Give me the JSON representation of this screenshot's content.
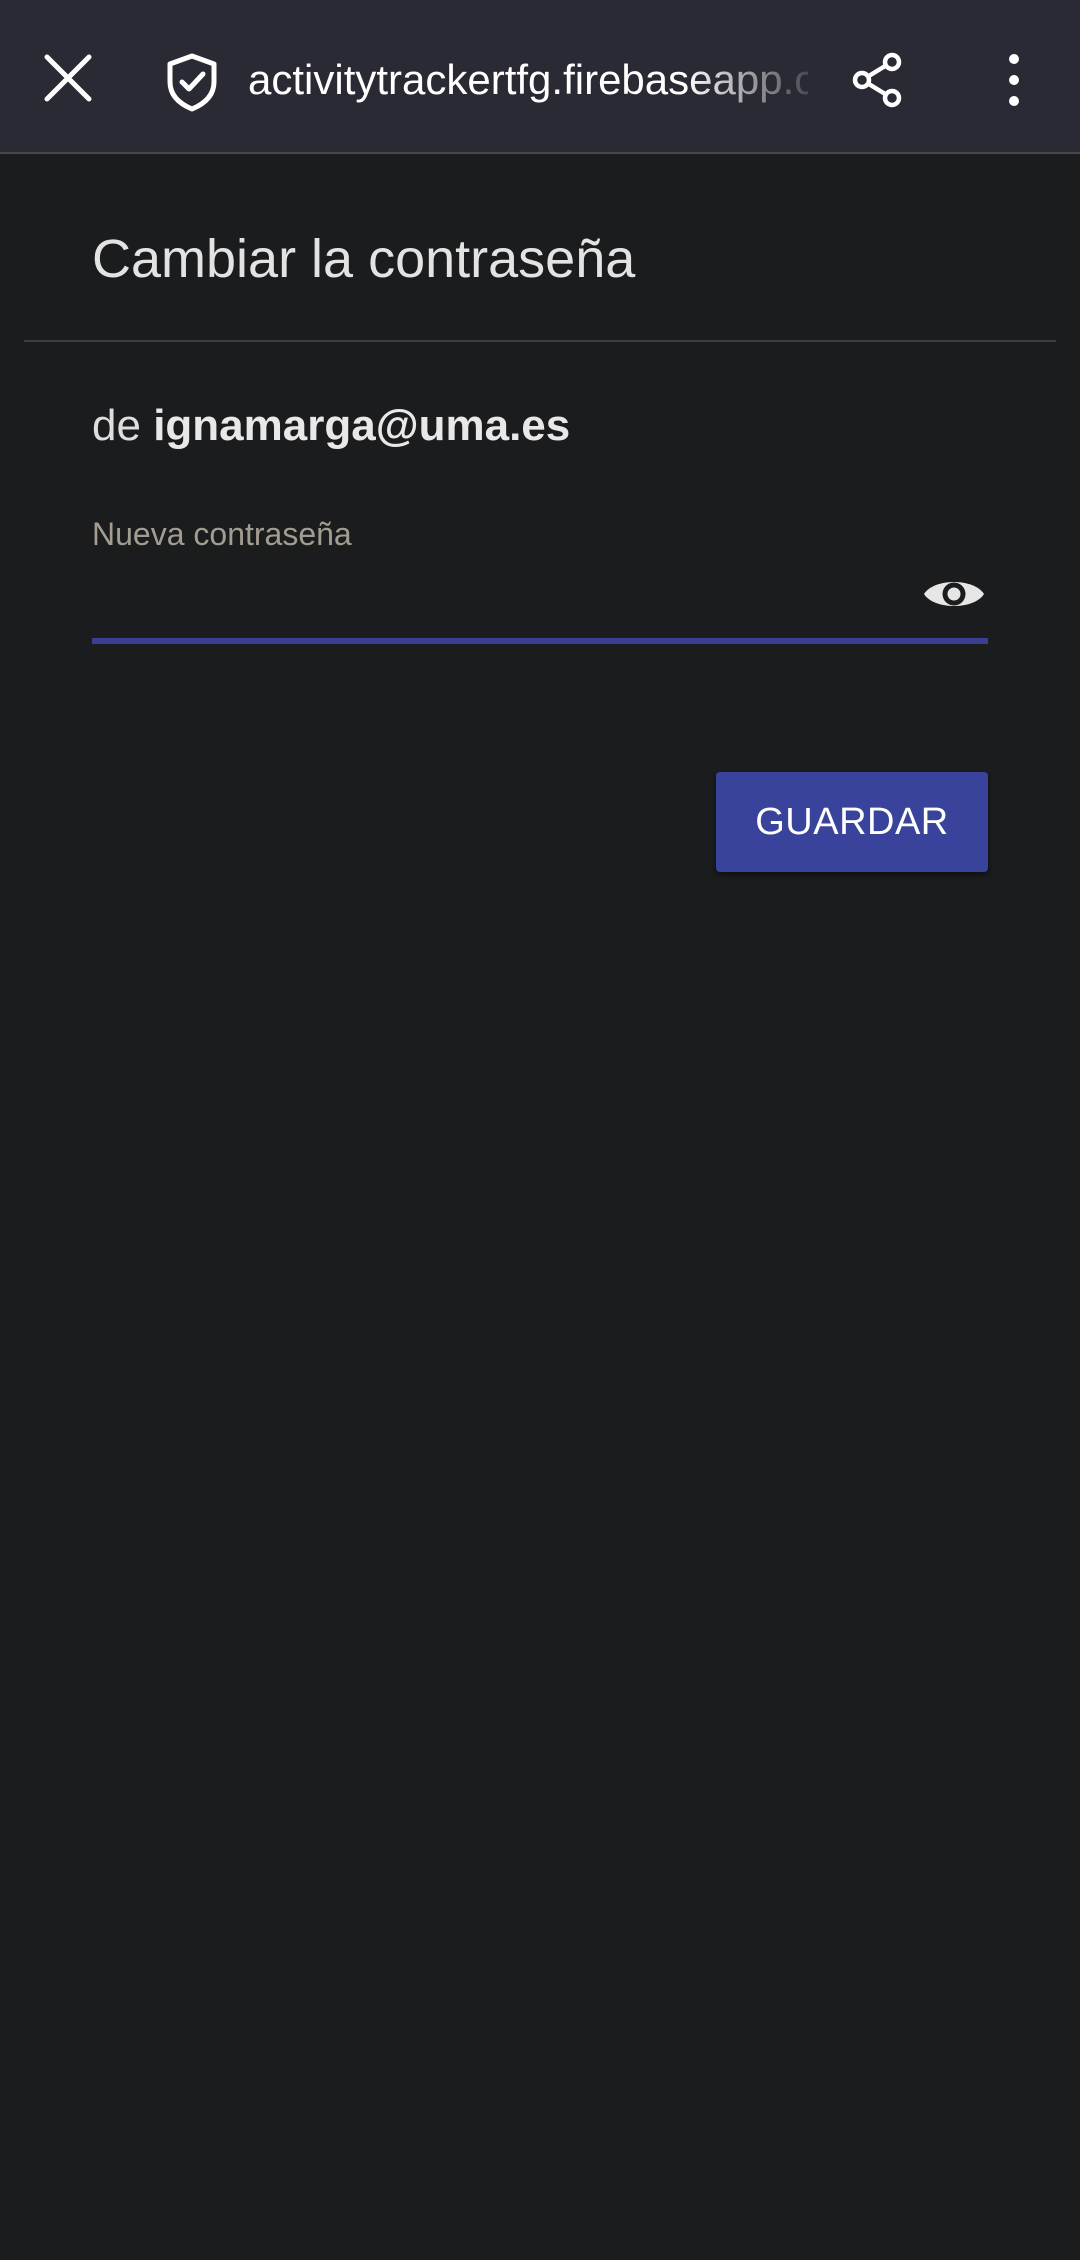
{
  "browser": {
    "url": "activitytrackertfg.firebaseapp.com",
    "icons": {
      "close": "close-icon",
      "security": "shield-check-icon",
      "share": "share-icon",
      "menu": "more-vertical-icon"
    }
  },
  "form": {
    "title": "Cambiar la contraseña",
    "subtitle_prefix": "de",
    "email": "ignamarga@uma.es",
    "password_label": "Nueva contraseña",
    "password_value": "",
    "visibility_icon": "eye-icon",
    "save_label": "GUARDAR"
  },
  "colors": {
    "background": "#1b1c1e",
    "toolbar": "#2a2a34",
    "accent": "#3a439b",
    "field_underline": "#3a3f94",
    "label_text": "#a39c90"
  }
}
